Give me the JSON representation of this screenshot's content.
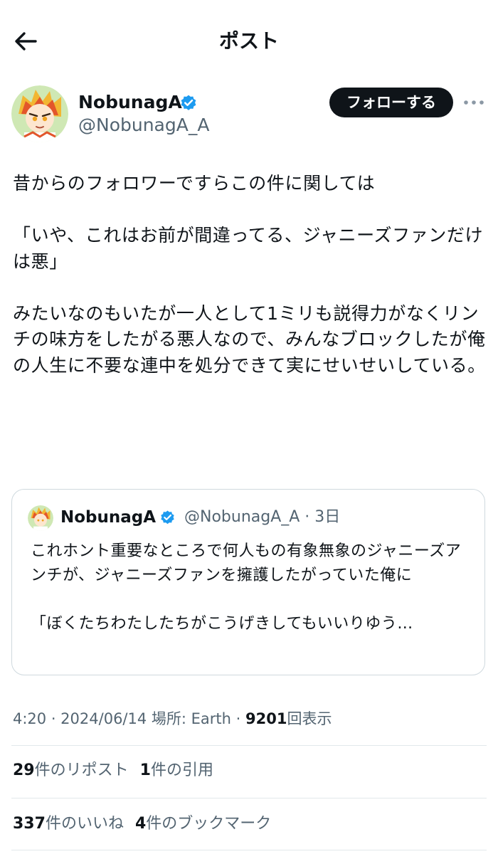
{
  "header": {
    "title": "ポスト",
    "back_icon": "arrow-left-icon"
  },
  "author": {
    "display_name": "NobunagA",
    "handle": "@NobunagA_A",
    "verified_icon": "verified-badge-icon",
    "follow_label": "フォローする",
    "more_icon": "more-horizontal-icon"
  },
  "post": {
    "paragraphs": [
      "昔からのフォロワーですらこの件に関しては",
      "「いや、これはお前が間違ってる、ジャニーズファンだけは悪」",
      "みたいなのもいたが一人として1ミリも説得力がなくリンチの味方をしたがる悪人なので、みんなブロックしたが俺の人生に不要な連中を処分できて実にせいせいしている。"
    ]
  },
  "quote": {
    "display_name": "NobunagA",
    "handle_time": "@NobunagA_A · 3日",
    "paragraphs": [
      "これホント重要なところで何人もの有象無象のジャニーズアンチが、ジャニーズファンを擁護したがっていた俺に",
      "「ぼくたちわたしたちがこうげきしてもいいりゆう…"
    ]
  },
  "meta": {
    "time": "4:20 · 2024/06/14 場所: Earth · ",
    "views": "9201",
    "views_label": "回表示"
  },
  "stats": {
    "reposts": "29",
    "reposts_label": "件のリポスト",
    "quotes": "1",
    "quotes_label": "件の引用",
    "likes": "337",
    "likes_label": "件のいいね",
    "bookmarks": "4",
    "bookmarks_label": "件のブックマーク"
  },
  "colors": {
    "text": "#0f1419",
    "secondary": "#536471",
    "verified": "#1d9bf0",
    "border": "#cfd9de"
  }
}
